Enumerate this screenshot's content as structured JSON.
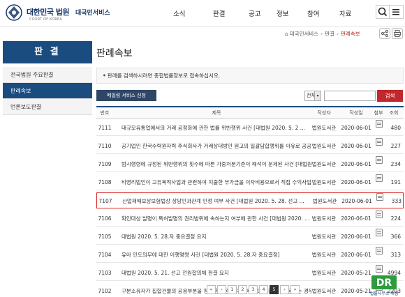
{
  "header": {
    "logo_title": "대한민국 법원",
    "logo_sub": "COURT OF KOREA",
    "site_name": "대국민서비스",
    "nav": [
      "소식",
      "판결",
      "공고",
      "정보",
      "참여",
      "자료"
    ]
  },
  "sidebar": {
    "title": "판 결",
    "items": [
      {
        "label": "전국법원 주요판결"
      },
      {
        "label": "판례속보"
      },
      {
        "label": "언론보도판결"
      }
    ]
  },
  "breadcrumb": {
    "items": [
      "대국민서비스",
      "판결",
      "판례속보"
    ]
  },
  "page_title": "판례속보",
  "notice": "판례를 검색하시려면 종합법률정보로 접속하십시오.",
  "mail_button": "메일링 서비스 신청",
  "search": {
    "select_value": "전체",
    "button": "검색"
  },
  "table": {
    "headers": [
      "번호",
      "제목",
      "작성자",
      "작성일",
      "첨부",
      "조회"
    ],
    "rows": [
      {
        "no": "7111",
        "title": "대규모유통업에서의 거래 공정화에 관한 법률 위반행위 사건 [대법원 2020. 5. 2 ...",
        "author": "법원도서관",
        "date": "2020-06-01",
        "views": "480"
      },
      {
        "no": "7110",
        "title": "공기업인 한국수력원자력 주식회사가 거래상대방인 원고의 일괄담합행위를 이유로 공공기관 ...",
        "author": "법원도서관",
        "date": "2020-06-01",
        "views": "227"
      },
      {
        "no": "7109",
        "title": "범시행령에 규정된 위반행위의 횟수에 따른 가중처분기준이 해석이 문제된 사건 [대법원 ...",
        "author": "법원도서관",
        "date": "2020-06-01",
        "views": "234"
      },
      {
        "no": "7108",
        "title": "비영리법인이 고유목적사업과 관련하여 지출한 부가금을 이자비용으로서 직접 수익사업의 ...",
        "author": "법원도서관",
        "date": "2020-06-01",
        "views": "191"
      },
      {
        "no": "7107",
        "title": "산업재해보상보험법상 상당인과관계 인정 여부 사건 [대법원 2020. 5. 28. 선고 ...",
        "author": "법원도서관",
        "date": "2020-06-01",
        "views": "333"
      },
      {
        "no": "7106",
        "title": "확인대상 발명이 특허발명의 권리범위에 속하는지 여부에 관한 사건 [대법원 2020. ...",
        "author": "법원도서관",
        "date": "2020-06-01",
        "views": "224"
      },
      {
        "no": "7105",
        "title": "대법원 2020. 5. 28.자 중요결정 요지",
        "author": "법원도서관",
        "date": "2020-06-01",
        "views": "366"
      },
      {
        "no": "7104",
        "title": "유아 인도의무에 대한 이행명령 사건 [대법원 2020. 5. 28.자 중요결정]",
        "author": "법원도서관",
        "date": "2020-06-01",
        "views": "313"
      },
      {
        "no": "7103",
        "title": "대법원 2020. 5. 21. 선고 전원합의체 판결 요지",
        "author": "법원도서관",
        "date": "2020-05-21",
        "views": "4994"
      },
      {
        "no": "7102",
        "title": "구분소유자가 집합건물의 공용부분을 정당한 권원 없이 배타적으로 점유 · 사용하는 경우 ...",
        "author": "법원도서관",
        "date": "2020-05-21",
        "views": "2203"
      }
    ]
  },
  "pagination": {
    "first": "«",
    "prev": "‹",
    "pages": [
      "1",
      "2",
      "3",
      "4",
      "5"
    ],
    "current": "5",
    "next": "›",
    "last": "»"
  },
  "watermark": {
    "mark": "DR",
    "caption": "법률사무소 대림"
  },
  "colors": {
    "brand": "#1b4c80",
    "highlight": "#d22222",
    "search_button": "#c0282d"
  },
  "icons": [
    "court-emblem-icon",
    "search-icon",
    "menu-icon",
    "home-icon",
    "share-icon",
    "print-icon",
    "attachment-icon"
  ]
}
